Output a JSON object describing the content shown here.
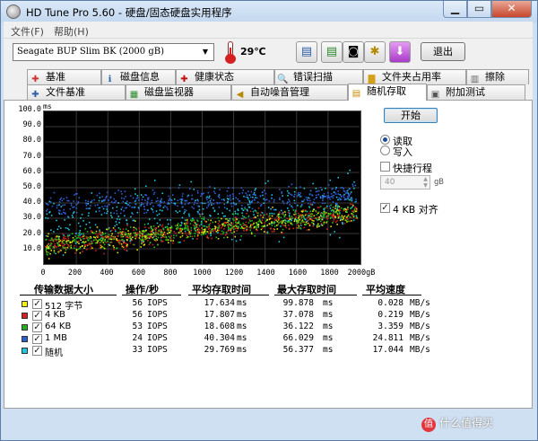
{
  "window": {
    "title": "HD Tune Pro 5.60 - 硬盘/固态硬盘实用程序",
    "buttons": {
      "minimize": "▁",
      "maximize": "▭",
      "close": "✕"
    }
  },
  "menu": {
    "items": [
      "文件(F)",
      "帮助(H)"
    ]
  },
  "toolbar": {
    "drive": "Seagate BUP Slim BK (2000 gB)",
    "temperature": "29℃",
    "exit_label": "退出",
    "icons": [
      "copy-info-icon",
      "copy-screen-icon",
      "screenshot-icon",
      "options-icon",
      "download-icon"
    ]
  },
  "tabs": {
    "row1": [
      {
        "label": "基准",
        "icon": "benchmark-icon"
      },
      {
        "label": "磁盘信息",
        "icon": "info-icon"
      },
      {
        "label": "健康状态",
        "icon": "health-icon"
      },
      {
        "label": "错误扫描",
        "icon": "scan-icon"
      },
      {
        "label": "文件夹占用率",
        "icon": "folder-icon"
      },
      {
        "label": "擦除",
        "icon": "erase-icon"
      }
    ],
    "row2": [
      {
        "label": "文件基准",
        "icon": "file-benchmark-icon"
      },
      {
        "label": "磁盘监视器",
        "icon": "monitor-icon"
      },
      {
        "label": "自动噪音管理",
        "icon": "speaker-icon"
      },
      {
        "label": "随机存取",
        "icon": "random-access-icon",
        "active": true
      },
      {
        "label": "附加测试",
        "icon": "extra-tests-icon"
      }
    ]
  },
  "controls": {
    "start_label": "开始",
    "read_label": "读取",
    "write_label": "写入",
    "mode": "read",
    "short_stroke_label": "快捷行程",
    "short_stroke_checked": false,
    "short_stroke_value": "40",
    "short_stroke_unit": "gB",
    "align_label": "4 KB 对齐",
    "align_checked": true
  },
  "chart_data": {
    "type": "scatter",
    "y_unit": "ms",
    "ylim": [
      0,
      100
    ],
    "yticks": [
      "100.0",
      "90.0",
      "80.0",
      "70.0",
      "60.0",
      "50.0",
      "40.0",
      "30.0",
      "20.0",
      "10.0"
    ],
    "xlim": [
      0,
      2000
    ],
    "xticks": [
      "0",
      "200",
      "400",
      "600",
      "800",
      "1000",
      "1200",
      "1400",
      "1600",
      "1800",
      "2000gB"
    ],
    "background": "#000000",
    "grid": true,
    "series": [
      {
        "name": "512 字节",
        "color": "#e6e600",
        "band": [
          17.6,
          3.5
        ],
        "trend": 0.0055
      },
      {
        "name": "4 KB",
        "color": "#d01f1f",
        "band": [
          17.8,
          3.5
        ],
        "trend": 0.0055
      },
      {
        "name": "64 KB",
        "color": "#1fb81f",
        "band": [
          18.6,
          3.5
        ],
        "trend": 0.0055
      },
      {
        "name": "1 MB",
        "color": "#2f5fd8",
        "band": [
          40.3,
          3.5
        ],
        "trend": 0.002
      },
      {
        "name": "随机",
        "color": "#1fc8e0",
        "band": [
          29.8,
          9.0
        ],
        "trend": 0.004
      }
    ]
  },
  "table": {
    "headers": [
      "传输数据大小",
      "操作/秒",
      "平均存取时间",
      "最大存取时间",
      "平均速度"
    ],
    "rows": [
      {
        "name": "512 字节",
        "color": "#f2f20a",
        "ops": "56",
        "ops_unit": "IOPS",
        "avg": "17.634",
        "avg_unit": "ms",
        "max": "99.878",
        "max_unit": "ms",
        "speed": "0.028",
        "speed_unit": "MB/s",
        "checked": true
      },
      {
        "name": "4 KB",
        "color": "#d81f1f",
        "ops": "56",
        "ops_unit": "IOPS",
        "avg": "17.807",
        "avg_unit": "ms",
        "max": "37.078",
        "max_unit": "ms",
        "speed": "0.219",
        "speed_unit": "MB/s",
        "checked": true
      },
      {
        "name": "64 KB",
        "color": "#22b022",
        "ops": "53",
        "ops_unit": "IOPS",
        "avg": "18.608",
        "avg_unit": "ms",
        "max": "36.122",
        "max_unit": "ms",
        "speed": "3.359",
        "speed_unit": "MB/s",
        "checked": true
      },
      {
        "name": "1 MB",
        "color": "#2b5fd0",
        "ops": "24",
        "ops_unit": "IOPS",
        "avg": "40.304",
        "avg_unit": "ms",
        "max": "66.029",
        "max_unit": "ms",
        "speed": "24.811",
        "speed_unit": "MB/s",
        "checked": true
      },
      {
        "name": "随机",
        "color": "#1fc8e0",
        "ops": "33",
        "ops_unit": "IOPS",
        "avg": "29.769",
        "avg_unit": "ms",
        "max": "56.377",
        "max_unit": "ms",
        "speed": "17.044",
        "speed_unit": "MB/s",
        "checked": true
      }
    ]
  },
  "watermark": {
    "logo": "值",
    "text": "什么值得买"
  }
}
